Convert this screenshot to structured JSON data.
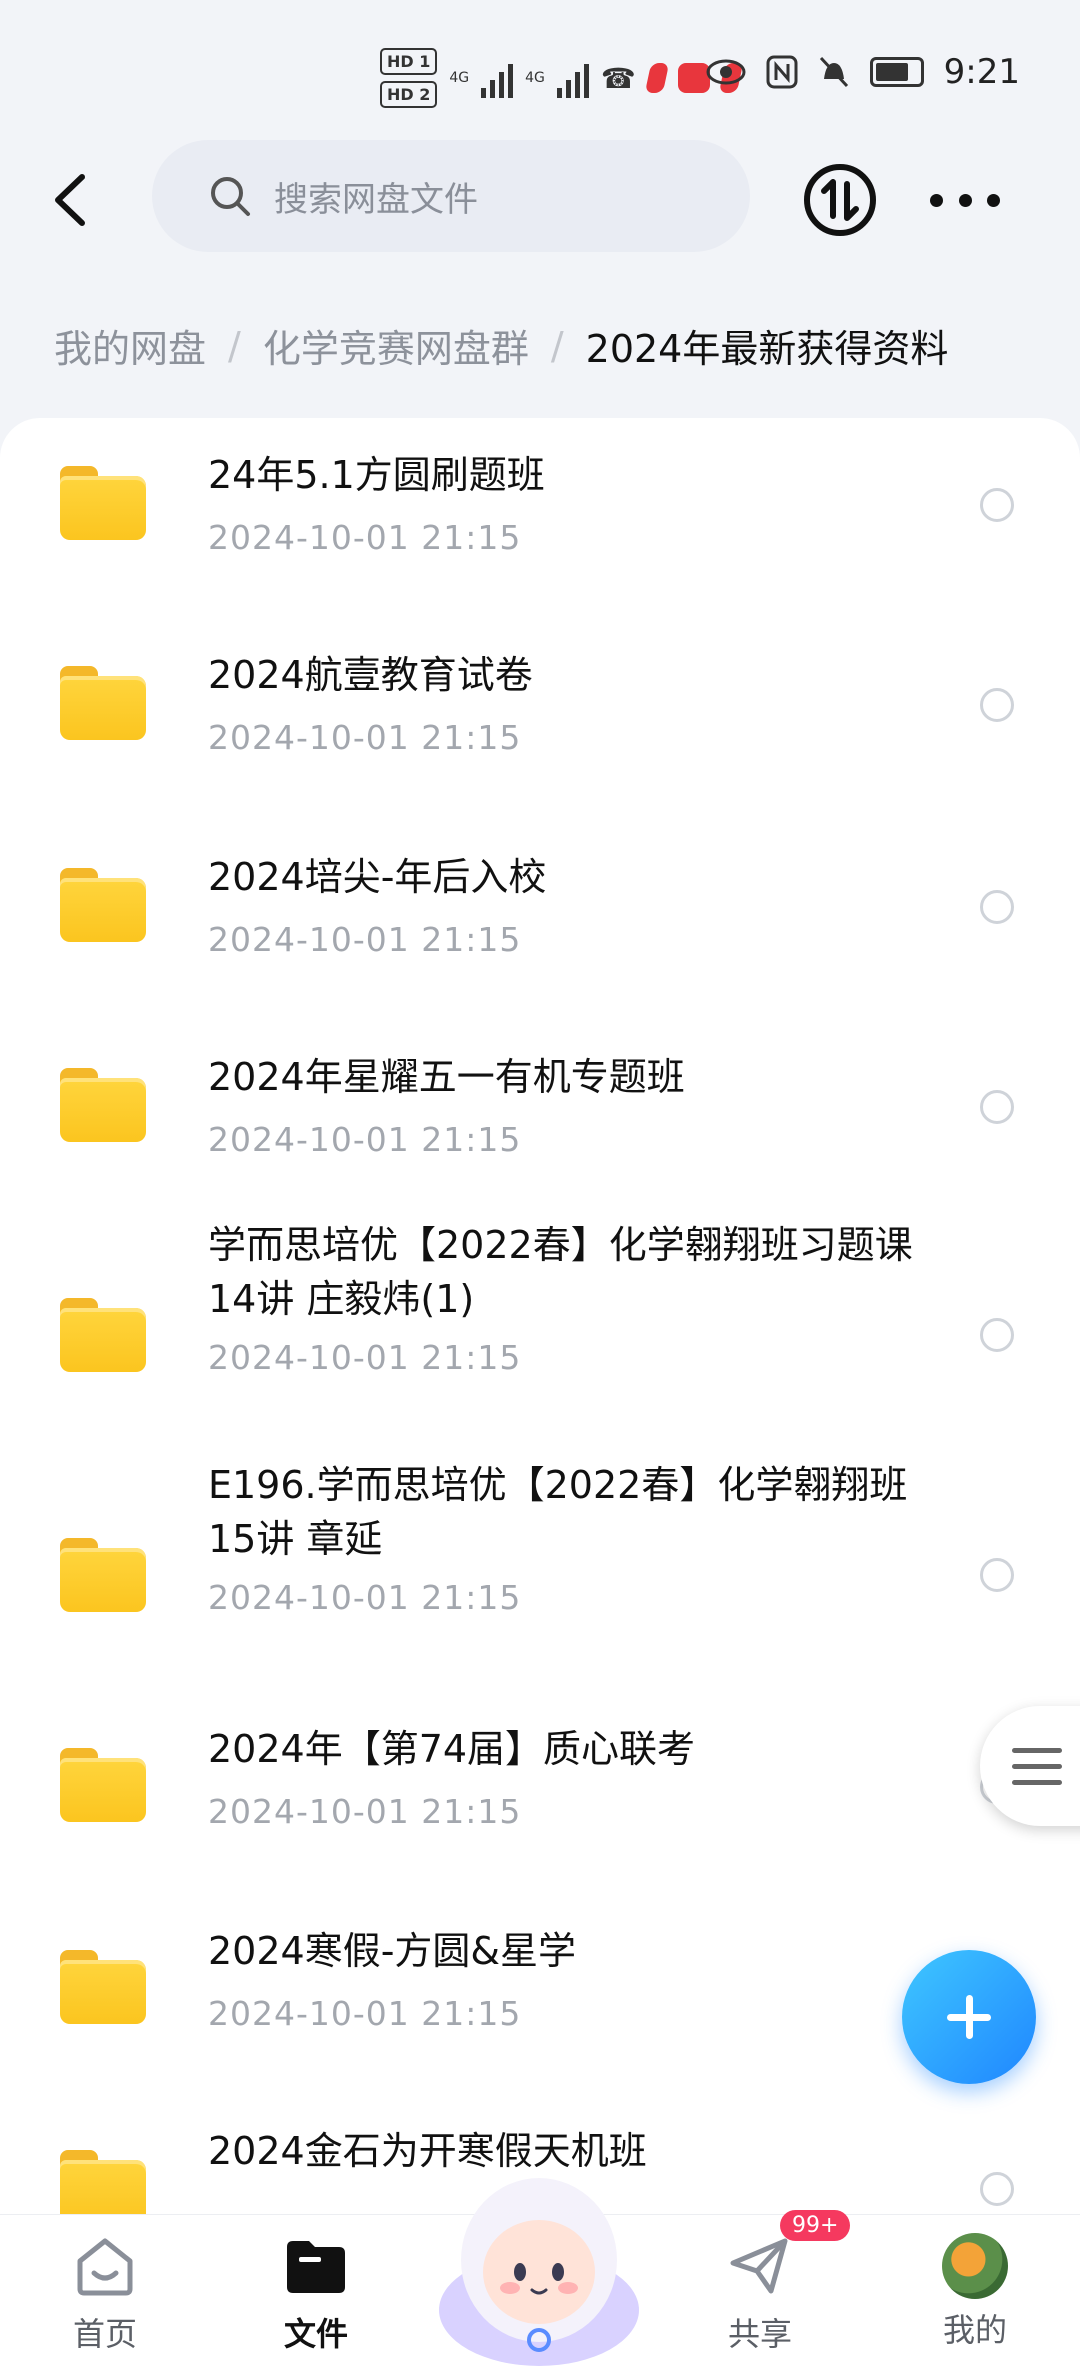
{
  "status_bar": {
    "hd1": "HD 1",
    "hd2": "HD 2",
    "net1": "4G",
    "net2": "4G",
    "time": "9:21",
    "icons": [
      "signal-icon",
      "eye-icon",
      "nfc-icon",
      "mute-icon",
      "battery-icon"
    ]
  },
  "header": {
    "search_placeholder": "搜索网盘文件"
  },
  "breadcrumb": {
    "items": [
      "我的网盘",
      "化学竞赛网盘群"
    ],
    "current": "2024年最新获得资料",
    "separator": "/"
  },
  "files": [
    {
      "name": "24年5.1方圆刷题班",
      "date": "2024-10-01  21:15"
    },
    {
      "name": "2024航壹教育试卷",
      "date": "2024-10-01  21:15"
    },
    {
      "name": "2024培尖-年后入校",
      "date": "2024-10-01  21:15"
    },
    {
      "name": "2024年星耀五一有机专题班",
      "date": "2024-10-01  21:15"
    },
    {
      "name": "学而思培优【2022春】化学翱翔班习题课14讲 庄毅炜(1)",
      "date": "2024-10-01  21:15"
    },
    {
      "name": "E196.学而思培优【2022春】化学翱翔班15讲 章延",
      "date": "2024-10-01  21:15"
    },
    {
      "name": "2024年【第74届】质心联考",
      "date": "2024-10-01  21:15"
    },
    {
      "name": "2024寒假-方圆&星学",
      "date": "2024-10-01  21:15"
    },
    {
      "name": "2024金石为开寒假天机班",
      "date": ""
    }
  ],
  "bottom_nav": {
    "home": "首页",
    "files": "文件",
    "share": "共享",
    "mine": "我的",
    "share_badge": "99+"
  },
  "colors": {
    "accent": "#1f86ff",
    "folder": "#fbc51f",
    "badge": "#f5395f"
  }
}
